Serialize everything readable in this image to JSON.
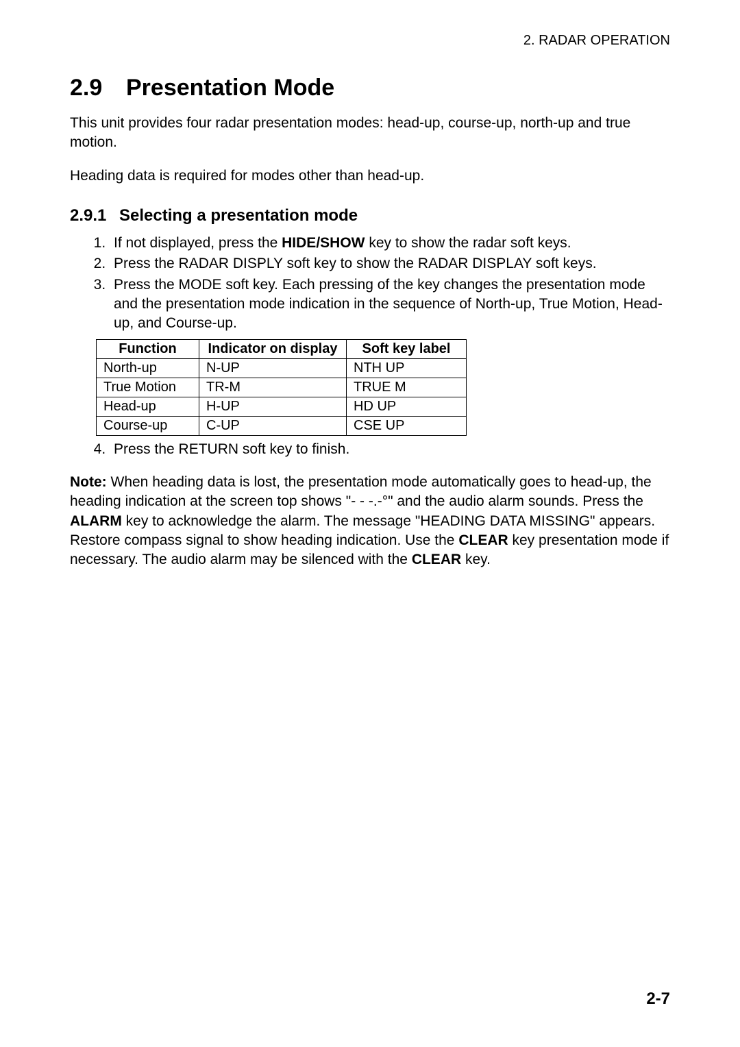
{
  "running_header": "2. RADAR OPERATION",
  "section": {
    "number": "2.9",
    "title": "Presentation Mode",
    "intro1": "This unit provides four radar presentation modes: head-up, course-up, north-up and true motion.",
    "intro2": "Heading data is required for modes other than head-up."
  },
  "subsection": {
    "number": "2.9.1",
    "title": "Selecting a presentation mode"
  },
  "steps": {
    "s1a": "If not displayed, press the ",
    "s1b": "HIDE/SHOW",
    "s1c": " key to show the radar soft keys.",
    "s2": "Press the RADAR DISPLY soft key to show the RADAR DISPLAY soft keys.",
    "s3": "Press the MODE soft key. Each pressing of the key changes the presentation mode and the presentation mode indication in the sequence of North-up, True Motion, Head-up, and Course-up.",
    "s4": "Press the RETURN soft key to finish."
  },
  "table": {
    "headers": {
      "func": "Function",
      "ind": "Indicator on display",
      "soft": "Soft key label"
    },
    "rows": [
      {
        "func": "North-up",
        "ind": "N-UP",
        "soft": "NTH UP"
      },
      {
        "func": "True Motion",
        "ind": "TR-M",
        "soft": "TRUE M"
      },
      {
        "func": "Head-up",
        "ind": "H-UP",
        "soft": "HD UP"
      },
      {
        "func": "Course-up",
        "ind": "C-UP",
        "soft": "CSE UP"
      }
    ]
  },
  "note": {
    "label": "Note:",
    "t1": " When heading data is lost, the presentation mode automatically goes to head-up, the heading indication at the screen top shows \"- - -.-°\" and the audio alarm sounds. Press the ",
    "k1": "ALARM",
    "t2": " key to acknowledge the alarm. The message \"HEADING DATA MISSING\" appears. Restore compass signal to show heading indication. Use the ",
    "k2": "CLEAR",
    "t3": " key presentation mode if necessary. The audio alarm may be silenced with the ",
    "k3": "CLEAR",
    "t4": " key."
  },
  "page_number": "2-7"
}
